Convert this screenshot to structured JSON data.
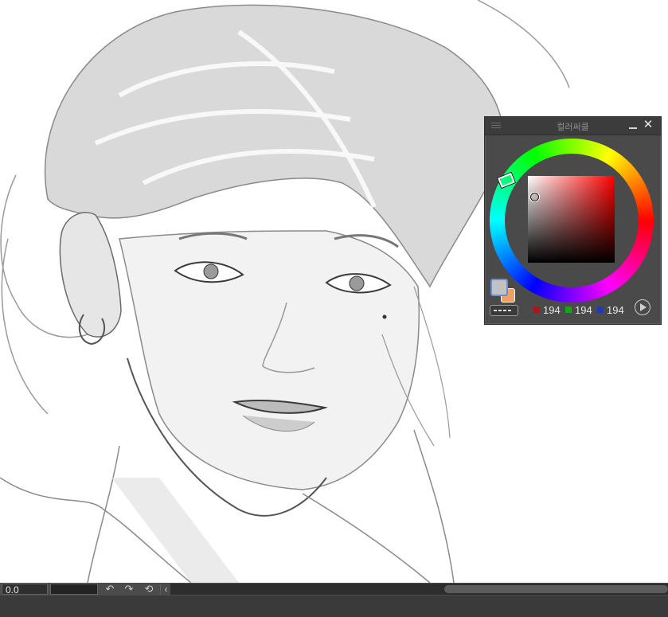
{
  "color_palette": {
    "title": "컬러써클",
    "hue_degrees": 0,
    "saturation_percent": 5,
    "brightness_percent": 80,
    "main_color": "#c2c2c2",
    "sub_color": "#f0a060",
    "rgb": {
      "r": "194",
      "g": "194",
      "b": "194"
    },
    "icons": [
      "palette-menu-icon",
      "minimize-icon",
      "close-icon",
      "play-icon",
      "transparent-color-icon"
    ]
  },
  "status_bar": {
    "rotation_value": "0.0",
    "icons": [
      "rotate-left-icon",
      "rotate-right-icon",
      "reset-rotation-icon",
      "collapse-left-icon"
    ],
    "glyphs": {
      "rotate_left": "↶",
      "rotate_right": "↷",
      "reset": "⟲",
      "collapse": "‹"
    }
  },
  "canvas": {
    "description_free": true,
    "content": "grayscale-illustration"
  },
  "colors": {
    "panel_bg": "#4a4a4a",
    "titlebar_bg": "#3c3c3c",
    "status_bg": "#3a3a3a",
    "accent_frame": "#6c8ecb"
  }
}
